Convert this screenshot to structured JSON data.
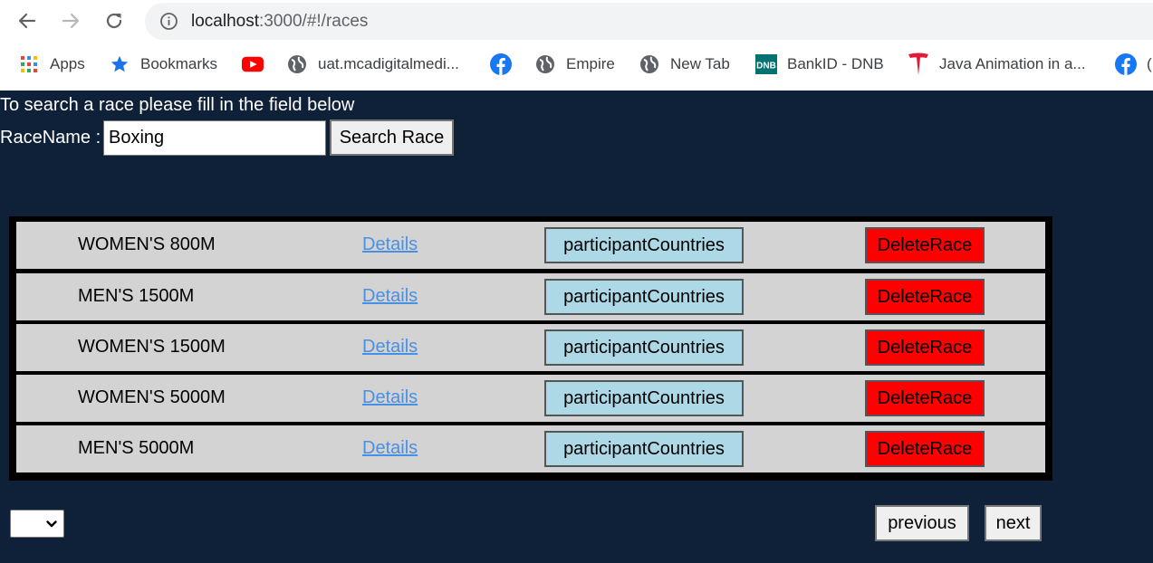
{
  "browser": {
    "url_host": "localhost",
    "url_rest": ":3000/#!/races",
    "bookmarks": [
      {
        "label": "Apps",
        "icon": "apps-grid-icon"
      },
      {
        "label": "Bookmarks",
        "icon": "star-icon"
      },
      {
        "label": "",
        "icon": "youtube-icon"
      },
      {
        "label": "uat.mcadigitalmedi...",
        "icon": "globe-icon"
      },
      {
        "label": "",
        "icon": "facebook-icon"
      },
      {
        "label": "Empire",
        "icon": "globe-icon"
      },
      {
        "label": "New Tab",
        "icon": "globe-icon"
      },
      {
        "label": "BankID - DNB",
        "icon": "dnb-icon"
      },
      {
        "label": "Java Animation in a...",
        "icon": "tesla-icon"
      },
      {
        "label": "(",
        "icon": "facebook-icon"
      }
    ]
  },
  "search": {
    "hint": "To search a race please fill in the field below",
    "label": "RaceName :",
    "value": "Boxing",
    "button": "Search Race"
  },
  "races": [
    {
      "name": "WOMEN'S 800M",
      "details": "Details",
      "countries": "participantCountries",
      "delete": "DeleteRace"
    },
    {
      "name": "MEN'S 1500M",
      "details": "Details",
      "countries": "participantCountries",
      "delete": "DeleteRace"
    },
    {
      "name": "WOMEN'S 1500M",
      "details": "Details",
      "countries": "participantCountries",
      "delete": "DeleteRace"
    },
    {
      "name": "WOMEN'S 5000M",
      "details": "Details",
      "countries": "participantCountries",
      "delete": "DeleteRace"
    },
    {
      "name": "MEN'S 5000M",
      "details": "Details",
      "countries": "participantCountries",
      "delete": "DeleteRace"
    }
  ],
  "pagination": {
    "page_size_value": "",
    "previous": "previous",
    "next": "next"
  },
  "colors": {
    "page_background": "#0f2138",
    "row_background": "#d3d3d3",
    "countries_button": "#add8e6",
    "delete_button": "#ff0000",
    "details_link": "#4a90e2"
  }
}
